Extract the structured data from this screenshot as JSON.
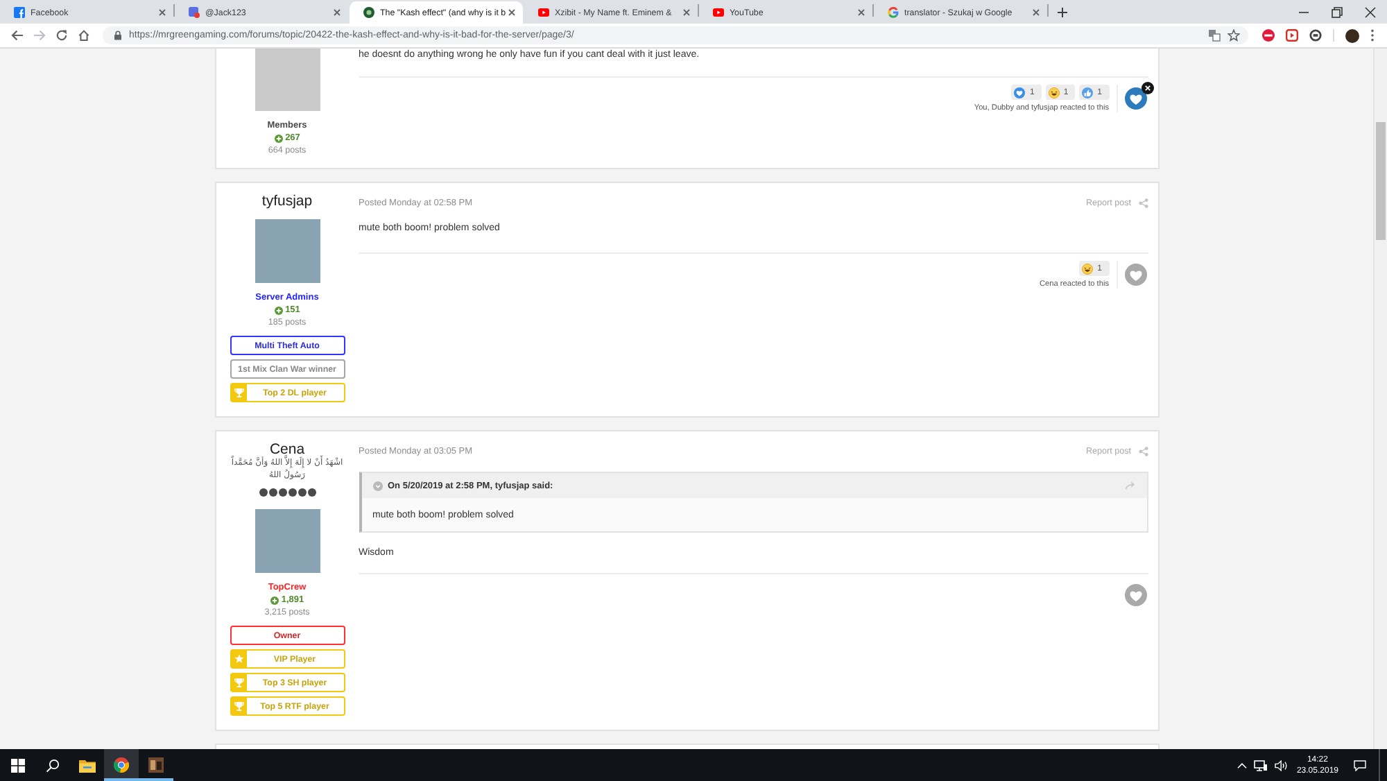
{
  "browser": {
    "tabs": [
      {
        "title": "Facebook",
        "kind": "facebook",
        "selected": false
      },
      {
        "title": "@Jack123",
        "kind": "chat",
        "selected": false
      },
      {
        "title": "The \"Kash effect\" (and why is it b",
        "kind": "site",
        "selected": true
      },
      {
        "title": "Xzibit - My Name ft. Eminem &",
        "kind": "video",
        "selected": false
      },
      {
        "title": "YouTube",
        "kind": "video",
        "selected": false
      },
      {
        "title": "translator - Szukaj w Google",
        "kind": "search",
        "selected": false
      }
    ],
    "address": "https://mrgreengaming.com/forums/topic/20422-the-kash-effect-and-why-is-it-bad-for-the-server/page/3/"
  },
  "posts": [
    {
      "author": {
        "group": {
          "label": "Members",
          "color": "#4a4a4a"
        },
        "reputation": "267",
        "post_count": "664 posts"
      },
      "body": "he doesnt do anything wrong he only have fun if you cant deal with it just leave.",
      "reactions": [
        {
          "kind": "like",
          "count": "1"
        },
        {
          "kind": "haha",
          "count": "1"
        },
        {
          "kind": "thanks",
          "count": "1"
        }
      ],
      "reacted_by": "You, Dubby and tyfusjap reacted to this",
      "reacted": true
    },
    {
      "author": {
        "name": "tyfusjap",
        "group": {
          "label": "Server Admins",
          "color": "#2424ff"
        },
        "reputation": "151",
        "post_count": "185 posts",
        "awards": [
          {
            "label": "Multi Theft Auto",
            "kind": "plain",
            "color": "#3434ff"
          },
          {
            "label": "1st Mix Clan War winner",
            "kind": "plain",
            "color": "#a6a6a6"
          },
          {
            "label": "Top 2 DL player",
            "kind": "trophy",
            "color": "#f2c811"
          }
        ]
      },
      "posted": "Posted Monday at 02:58 PM",
      "report": "Report post",
      "body": "mute both boom! problem solved",
      "reactions": [
        {
          "kind": "haha",
          "count": "1"
        }
      ],
      "reacted_by": "Cena reacted to this",
      "reacted": false
    },
    {
      "author": {
        "name": "Cena",
        "title": "اشْهَدُ أَنْ لا إِلَهَ إِلاَّ اللهُ وَأنَّ مُحَمَّداً رَسُولُ اللهُ",
        "rank": {
          "stars": 6
        },
        "group": {
          "label": "TopCrew",
          "color": "#ff2424"
        },
        "reputation": "1,891",
        "post_count": "3,215 posts",
        "awards": [
          {
            "label": "Owner",
            "kind": "plain",
            "color": "#ff3030"
          },
          {
            "label": "VIP Player",
            "kind": "star",
            "color": "#f2c811"
          },
          {
            "label": "Top 3 SH player",
            "kind": "trophy",
            "color": "#f2c811"
          },
          {
            "label": "Top 5 RTF player",
            "kind": "trophy",
            "color": "#f2c811"
          }
        ]
      },
      "posted": "Posted Monday at 03:05 PM",
      "report": "Report post",
      "quote": {
        "citation": "On 5/20/2019 at 2:58 PM, tyfusjap said:",
        "text": "mute both boom! problem solved"
      },
      "body": "Wisdom",
      "reacted": false
    }
  ],
  "taskbar": {
    "apps": [
      {
        "kind": "explorer",
        "running": false,
        "selected": false
      },
      {
        "kind": "browser",
        "running": true,
        "selected": true
      },
      {
        "kind": "media",
        "running": true,
        "selected": false
      }
    ],
    "time": "14:22",
    "date": "23.05.2019"
  }
}
